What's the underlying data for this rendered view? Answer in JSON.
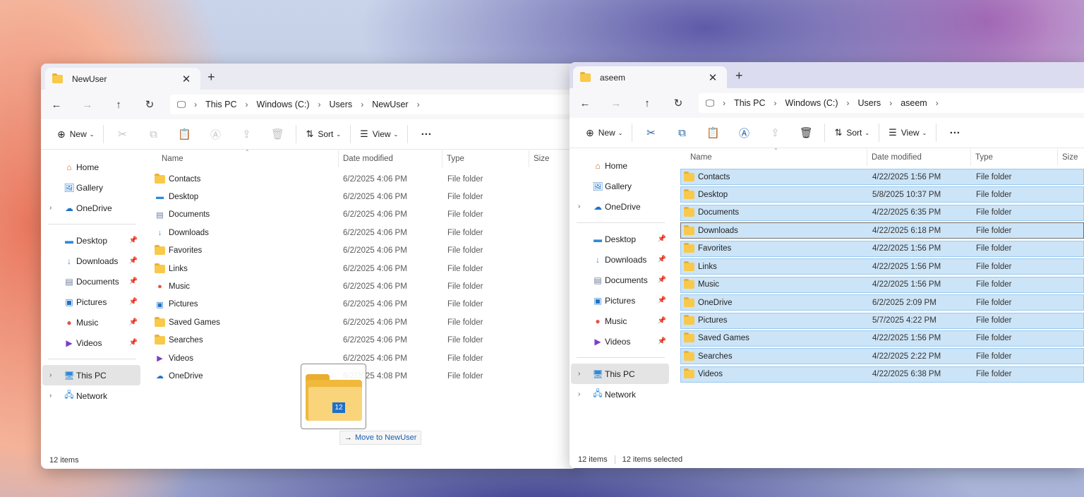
{
  "left_window": {
    "tab_title": "NewUser",
    "breadcrumb": [
      "This PC",
      "Windows (C:)",
      "Users",
      "NewUser"
    ],
    "commands": {
      "new": "New",
      "sort": "Sort",
      "view": "View"
    },
    "sidebar": {
      "top": [
        "Home",
        "Gallery",
        "OneDrive"
      ],
      "pinned": [
        "Desktop",
        "Downloads",
        "Documents",
        "Pictures",
        "Music",
        "Videos"
      ],
      "bottom": [
        "This PC",
        "Network"
      ]
    },
    "columns": {
      "name": "Name",
      "date": "Date modified",
      "type": "Type",
      "size": "Size"
    },
    "files": [
      {
        "name": "Contacts",
        "date": "6/2/2025 4:06 PM",
        "type": "File folder"
      },
      {
        "name": "Desktop",
        "date": "6/2/2025 4:06 PM",
        "type": "File folder"
      },
      {
        "name": "Documents",
        "date": "6/2/2025 4:06 PM",
        "type": "File folder"
      },
      {
        "name": "Downloads",
        "date": "6/2/2025 4:06 PM",
        "type": "File folder"
      },
      {
        "name": "Favorites",
        "date": "6/2/2025 4:06 PM",
        "type": "File folder"
      },
      {
        "name": "Links",
        "date": "6/2/2025 4:06 PM",
        "type": "File folder"
      },
      {
        "name": "Music",
        "date": "6/2/2025 4:06 PM",
        "type": "File folder"
      },
      {
        "name": "Pictures",
        "date": "6/2/2025 4:06 PM",
        "type": "File folder"
      },
      {
        "name": "Saved Games",
        "date": "6/2/2025 4:06 PM",
        "type": "File folder"
      },
      {
        "name": "Searches",
        "date": "6/2/2025 4:06 PM",
        "type": "File folder"
      },
      {
        "name": "Videos",
        "date": "6/2/2025 4:06 PM",
        "type": "File folder"
      },
      {
        "name": "OneDrive",
        "date": "6/2/2025 4:08 PM",
        "type": "File folder"
      }
    ],
    "status": "12 items"
  },
  "right_window": {
    "tab_title": "aseem",
    "breadcrumb": [
      "This PC",
      "Windows (C:)",
      "Users",
      "aseem"
    ],
    "commands": {
      "new": "New",
      "sort": "Sort",
      "view": "View"
    },
    "sidebar": {
      "top": [
        "Home",
        "Gallery",
        "OneDrive"
      ],
      "pinned": [
        "Desktop",
        "Downloads",
        "Documents",
        "Pictures",
        "Music",
        "Videos"
      ],
      "bottom": [
        "This PC",
        "Network"
      ]
    },
    "columns": {
      "name": "Name",
      "date": "Date modified",
      "type": "Type",
      "size": "Size"
    },
    "files": [
      {
        "name": "Contacts",
        "date": "4/22/2025 1:56 PM",
        "type": "File folder"
      },
      {
        "name": "Desktop",
        "date": "5/8/2025 10:37 PM",
        "type": "File folder"
      },
      {
        "name": "Documents",
        "date": "4/22/2025 6:35 PM",
        "type": "File folder"
      },
      {
        "name": "Downloads",
        "date": "4/22/2025 6:18 PM",
        "type": "File folder"
      },
      {
        "name": "Favorites",
        "date": "4/22/2025 1:56 PM",
        "type": "File folder"
      },
      {
        "name": "Links",
        "date": "4/22/2025 1:56 PM",
        "type": "File folder"
      },
      {
        "name": "Music",
        "date": "4/22/2025 1:56 PM",
        "type": "File folder"
      },
      {
        "name": "OneDrive",
        "date": "6/2/2025 2:09 PM",
        "type": "File folder"
      },
      {
        "name": "Pictures",
        "date": "5/7/2025 4:22 PM",
        "type": "File folder"
      },
      {
        "name": "Saved Games",
        "date": "4/22/2025 1:56 PM",
        "type": "File folder"
      },
      {
        "name": "Searches",
        "date": "4/22/2025 2:22 PM",
        "type": "File folder"
      },
      {
        "name": "Videos",
        "date": "4/22/2025 6:38 PM",
        "type": "File folder"
      }
    ],
    "status": "12 items",
    "status_selected": "12 items selected"
  },
  "drag": {
    "count": "12",
    "tip_prefix": "→",
    "tip_text": "Move to NewUser"
  }
}
